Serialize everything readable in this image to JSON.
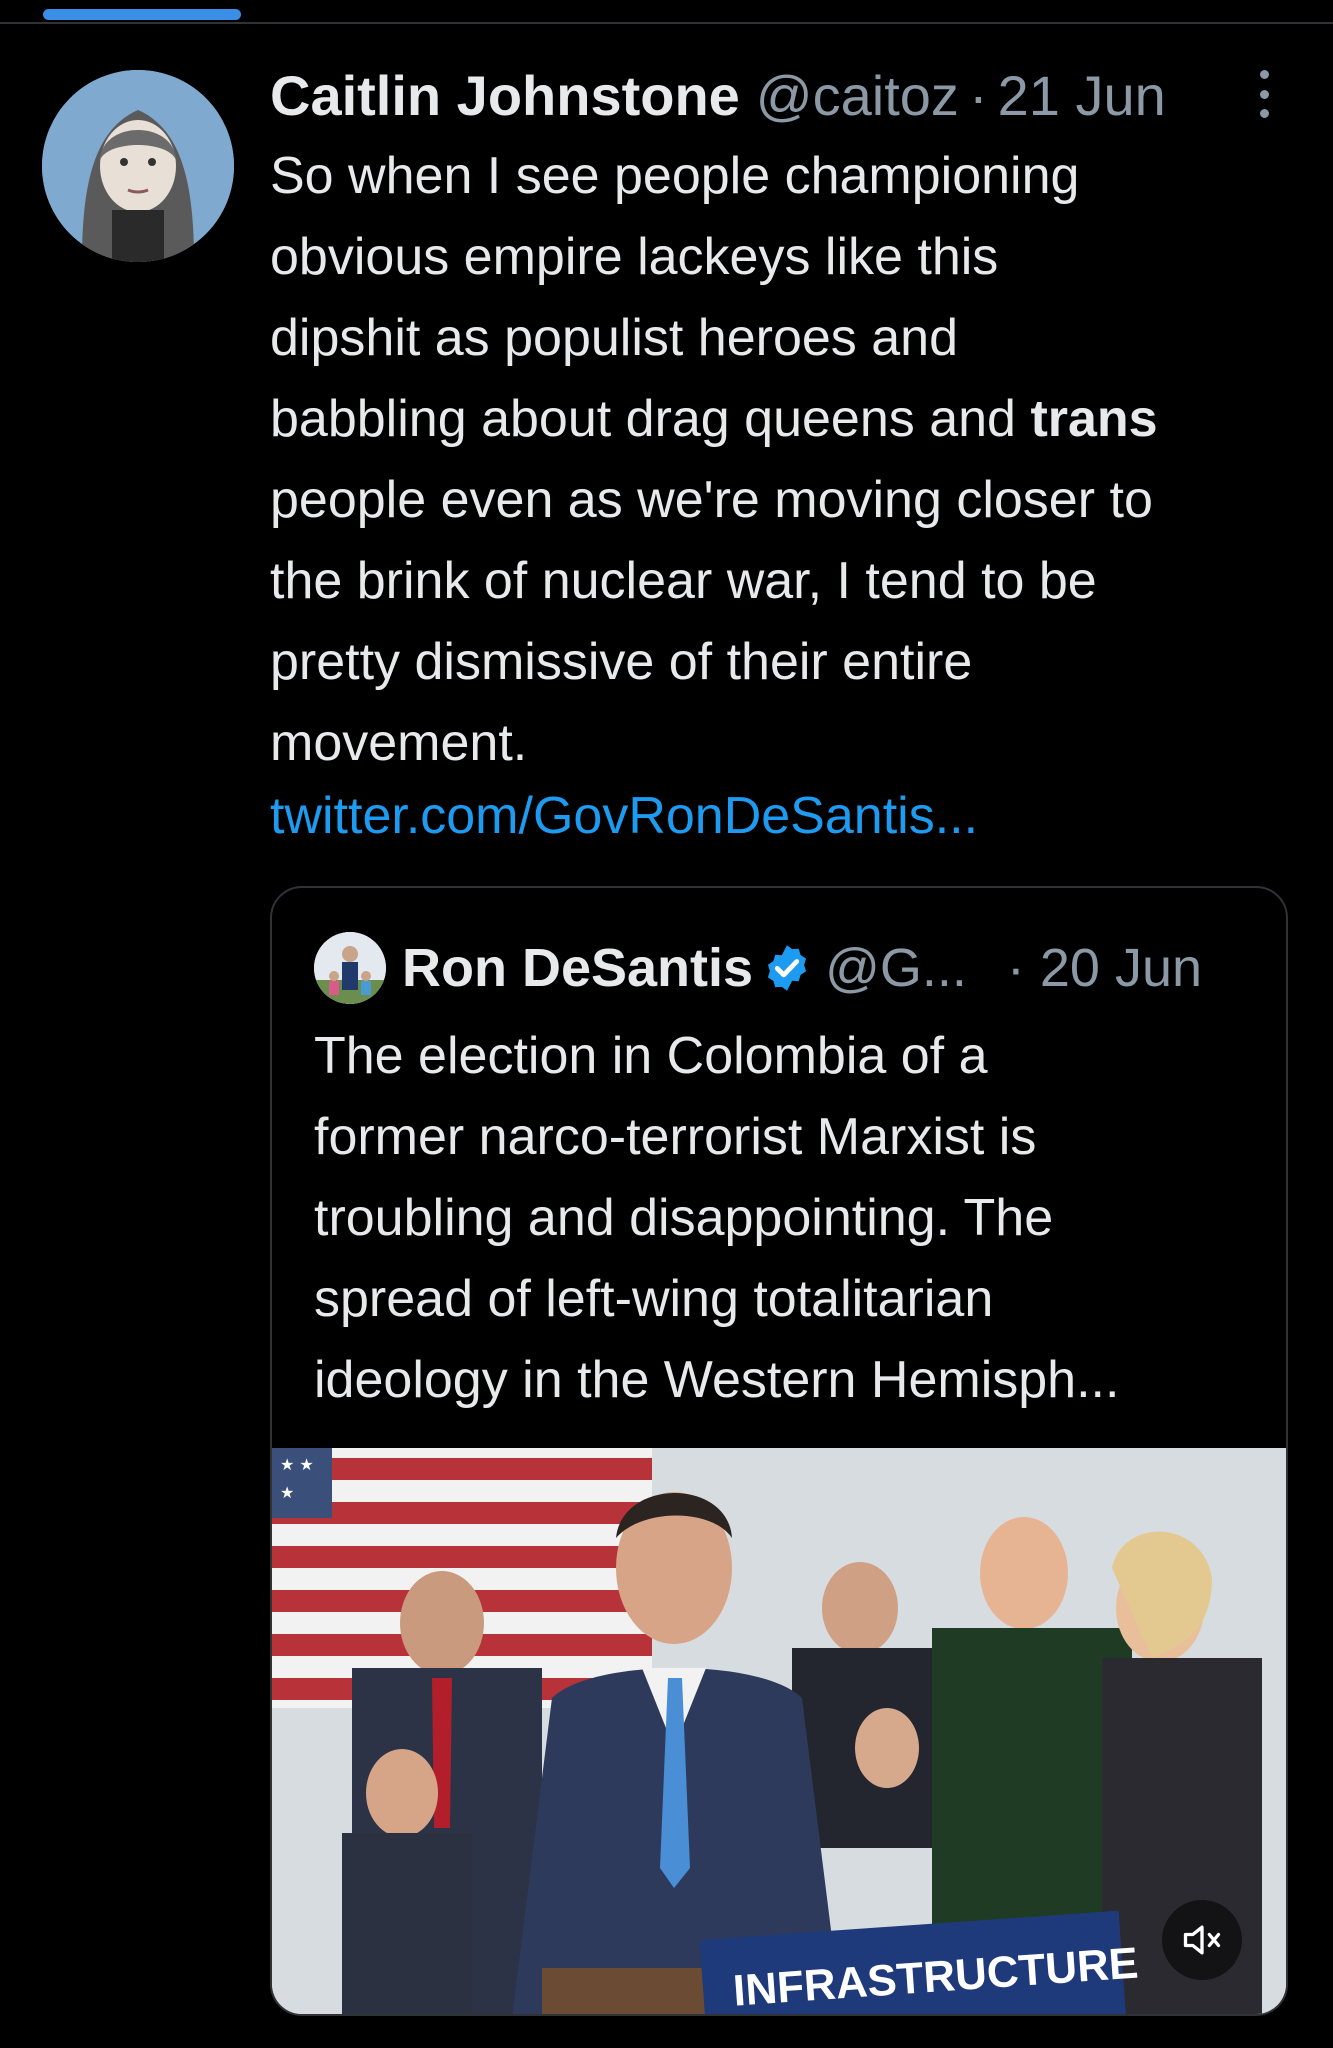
{
  "tweet": {
    "author_name": "Caitlin Johnstone",
    "handle": "@caitoz",
    "separator": "·",
    "date": "21 Jun",
    "lines": [
      "So when I see people championing",
      "obvious empire lackeys like this",
      "dipshit as populist heroes and",
      "babbling about drag queens and ",
      "people even as we're moving closer to",
      "the brink of nuclear war, I tend to be",
      "pretty dismissive of their entire",
      "movement."
    ],
    "bold_word": "trans",
    "link": "twitter.com/GovRonDeSantis..."
  },
  "quoted_tweet": {
    "author_name": "Ron DeSantis",
    "handle": "@G...",
    "date": "· 20 Jun",
    "lines": [
      "The election in Colombia of a",
      "former narco-terrorist Marxist is",
      "troubling and disappointing. The",
      "spread of left-wing totalitarian",
      "ideology in the Western Hemisph..."
    ],
    "media_sign_text": "INFRASTRUCTURE"
  },
  "icons": {
    "more": "more-vertical-icon",
    "verified": "verified-badge-icon",
    "mute": "volume-muted-icon"
  },
  "colors": {
    "background": "#000000",
    "link": "#1d9bf0",
    "verified": "#1d9bf0",
    "secondary_text": "#8b98a5"
  }
}
